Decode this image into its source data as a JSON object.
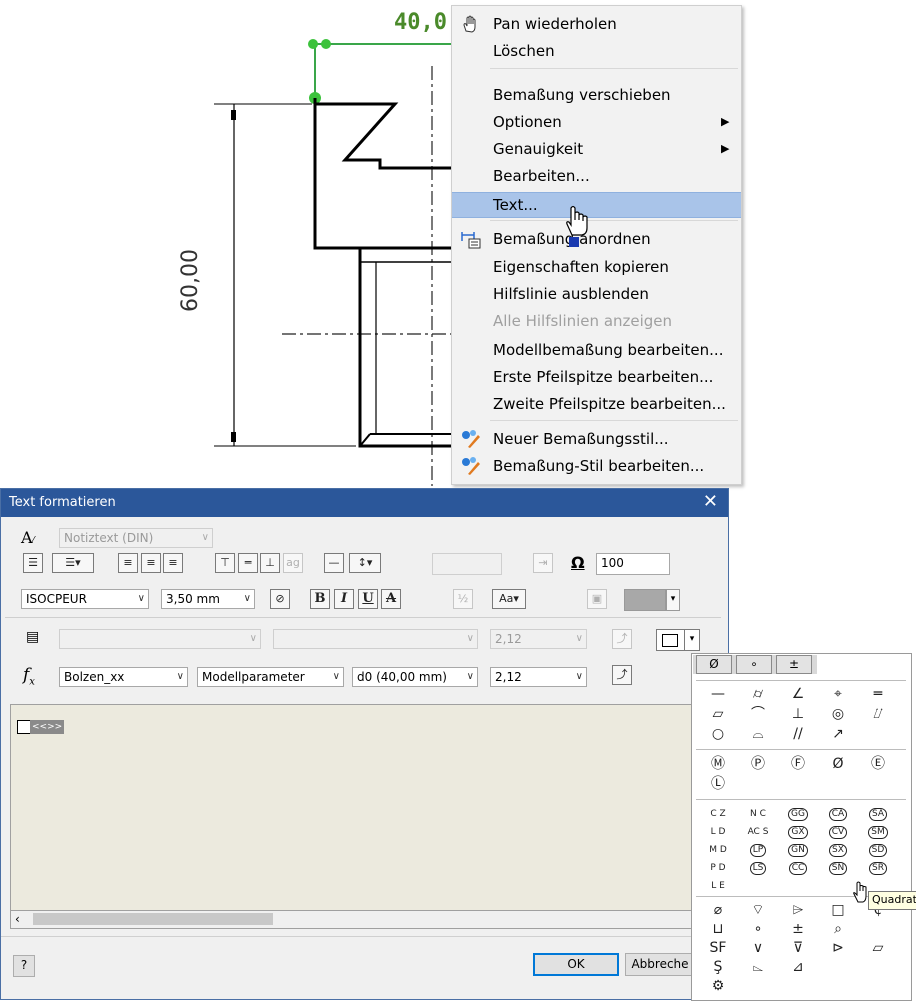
{
  "drawing": {
    "top_dimension": "40,0(",
    "side_dimension": "60,00"
  },
  "context_menu": {
    "items": [
      {
        "label": "Pan wiederholen",
        "icon": "hand-icon"
      },
      {
        "label": "Löschen"
      },
      {
        "label": "Bemaßung verschieben"
      },
      {
        "label": "Optionen",
        "submenu": true
      },
      {
        "label": "Genauigkeit",
        "submenu": true
      },
      {
        "label": "Bearbeiten..."
      },
      {
        "label": "Text...",
        "highlighted": true
      },
      {
        "label": "Bemaßung   anordnen",
        "icon": "arrange-dimensions-icon"
      },
      {
        "label": "Eigenschaften kopieren"
      },
      {
        "label": "Hilfslinie ausblenden"
      },
      {
        "label": "Alle Hilfslinien anzeigen",
        "disabled": true
      },
      {
        "label": "Modellbemaßung bearbeiten..."
      },
      {
        "label": "Erste Pfeilspitze bearbeiten..."
      },
      {
        "label": "Zweite Pfeilspitze bearbeiten..."
      },
      {
        "label": "Neuer Bemaßungsstil...",
        "icon": "style-icon"
      },
      {
        "label": "Bemaßung-Stil bearbeiten...",
        "icon": "style-icon"
      }
    ]
  },
  "dialog": {
    "title": "Text formatieren",
    "close": "✕",
    "style_combo": "Notiztext (DIN)",
    "font_combo": "ISOCPEUR",
    "size_combo": "3,50 mm",
    "width_percent": "100",
    "param_combo1": "",
    "param_combo2": "",
    "param_value_disabled": "2,12",
    "component_combo": "Bolzen_xx",
    "source_combo": "Modellparameter",
    "parameter_combo": "d0 (40,00 mm)",
    "precision_combo": "2,12",
    "text_content": "<<>>",
    "buttons": {
      "ok": "OK",
      "cancel": "Abbreche",
      "help": "?"
    },
    "toolbar_labels": {
      "bold": "B",
      "italic": "I",
      "underline": "U",
      "strike": "A",
      "ag": "ag",
      "omega": "Ω",
      "fx": "f",
      "fx_sub": "x"
    }
  },
  "palette": {
    "tabs": [
      "Ø",
      "∘",
      "±"
    ],
    "rows1": [
      [
        "—",
        "⌭",
        "∠",
        "⌖",
        "═"
      ],
      [
        "▱",
        "⌒",
        "⊥",
        "◎",
        "⌰"
      ],
      [
        "○",
        "⌓",
        "//",
        "↗",
        ""
      ]
    ],
    "rows2": [
      [
        "Ⓜ",
        "Ⓟ",
        "Ⓕ",
        "Ø",
        "Ⓔ"
      ],
      [
        "Ⓛ",
        "",
        "",
        "",
        ""
      ]
    ],
    "rows3": [
      [
        "C Z",
        "N C",
        "GG",
        "CA",
        "SA"
      ],
      [
        "L D",
        "AC S",
        "GX",
        "CV",
        "SM"
      ],
      [
        "M D",
        "LP",
        "GN",
        "SX",
        "SD"
      ],
      [
        "P D",
        "LS",
        "CC",
        "SN",
        "SR"
      ],
      [
        "L E",
        "",
        "",
        "",
        ""
      ]
    ],
    "rows4": [
      [
        "⌀",
        "⌔",
        "⌲",
        "□",
        "¢"
      ],
      [
        "⊔",
        "∘",
        "±",
        "⌕",
        ""
      ],
      [
        "SF",
        "∨",
        "⊽",
        "⊳",
        "⏥"
      ],
      [
        "Ş",
        "⌳",
        "⊿",
        "",
        ""
      ],
      [
        "⚙",
        "",
        "",
        "",
        ""
      ]
    ],
    "tooltip": "Quadrat"
  }
}
